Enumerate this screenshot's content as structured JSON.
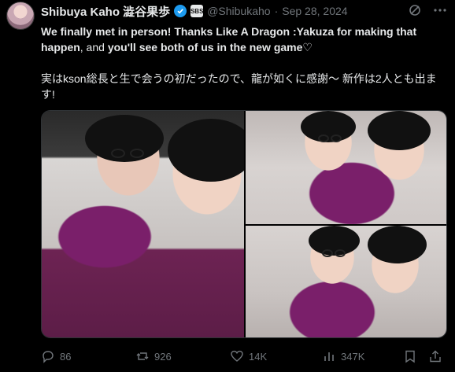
{
  "author": {
    "display_name": "Shibuya Kaho 澁谷果歩",
    "handle": "@Shibukaho",
    "separator": "·",
    "date": "Sep 28, 2024",
    "affiliate_badge_text": "SBS",
    "verified_color": "#1d9bf0"
  },
  "tweet": {
    "line1_bold": "We finally met in person! Thanks Like A Dragon :Yakuza for making that happen",
    "line1_rest": ", and ",
    "line1_bold2": "you'll see both of us in the new game",
    "line1_end": "♡",
    "line2": "実はkson総長と生で会うの初だったので、龍が如くに感謝〜 新作は2人とも出ます!"
  },
  "media": {
    "images": [
      "photo-1",
      "photo-2",
      "photo-3"
    ]
  },
  "actions": {
    "replies": "86",
    "reposts": "926",
    "likes": "14K",
    "views": "347K"
  },
  "icons": {
    "reply": "reply-icon",
    "repost": "repost-icon",
    "like": "heart-icon",
    "views": "views-icon",
    "bookmark": "bookmark-icon",
    "share": "share-icon",
    "grok": "grok-icon",
    "more": "more-icon"
  },
  "colors": {
    "background": "#000000",
    "text": "#e7e9ea",
    "muted": "#71767b",
    "border": "#2f3336"
  }
}
